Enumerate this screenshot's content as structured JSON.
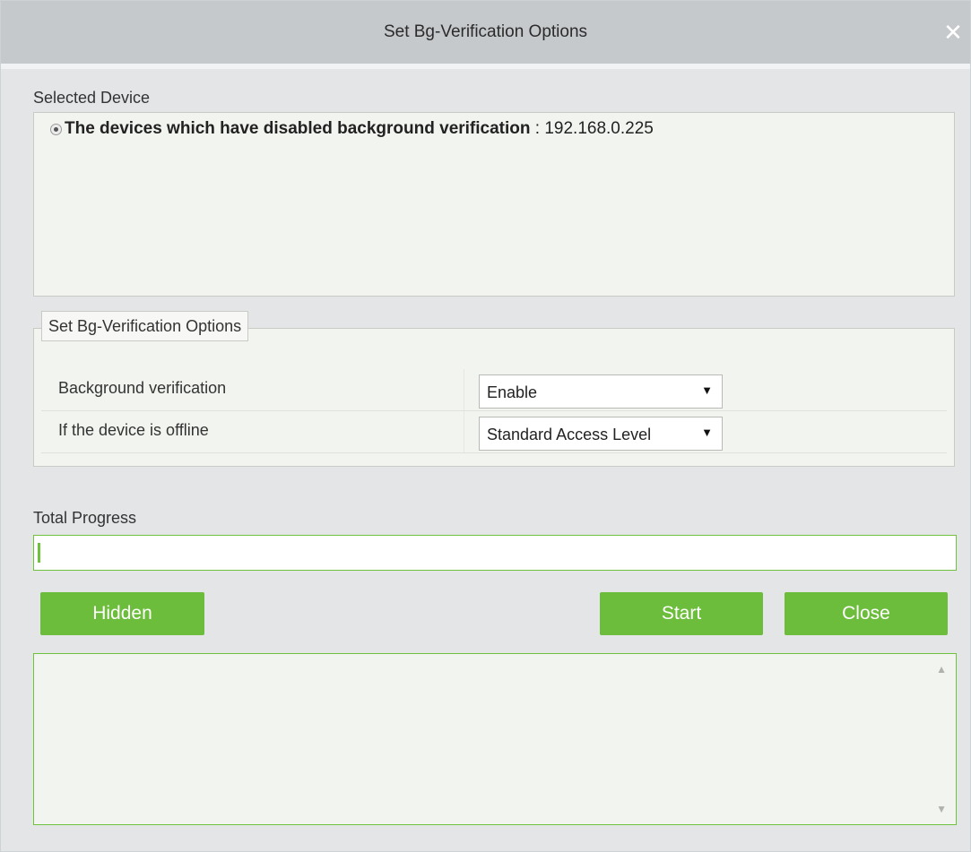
{
  "dialog": {
    "title": "Set Bg-Verification Options",
    "close_glyph": "✕"
  },
  "selected_device": {
    "label": "Selected Device",
    "device_bold": "The devices which have disabled background verification",
    "device_sep": " : ",
    "device_ip": "192.168.0.225"
  },
  "options": {
    "legend": "Set Bg-Verification Options",
    "rows": [
      {
        "label": "Background verification",
        "value": "Enable",
        "arrow": "▼"
      },
      {
        "label": "If the device is offline",
        "value": "Standard Access Level",
        "arrow": "▼"
      }
    ]
  },
  "progress": {
    "label": "Total Progress",
    "value_percent": 0
  },
  "buttons": {
    "hidden": "Hidden",
    "start": "Start",
    "close": "Close"
  },
  "log": {
    "scroll_up": "▲",
    "scroll_down": "▼"
  },
  "colors": {
    "accent_green": "#6cbd3b",
    "title_bar": "#c6c9cc",
    "panel_bg": "#f2f4ef"
  },
  "icons": [
    "close-icon",
    "radio-icon",
    "dropdown-arrow-icon",
    "scroll-up-icon",
    "scroll-down-icon"
  ]
}
